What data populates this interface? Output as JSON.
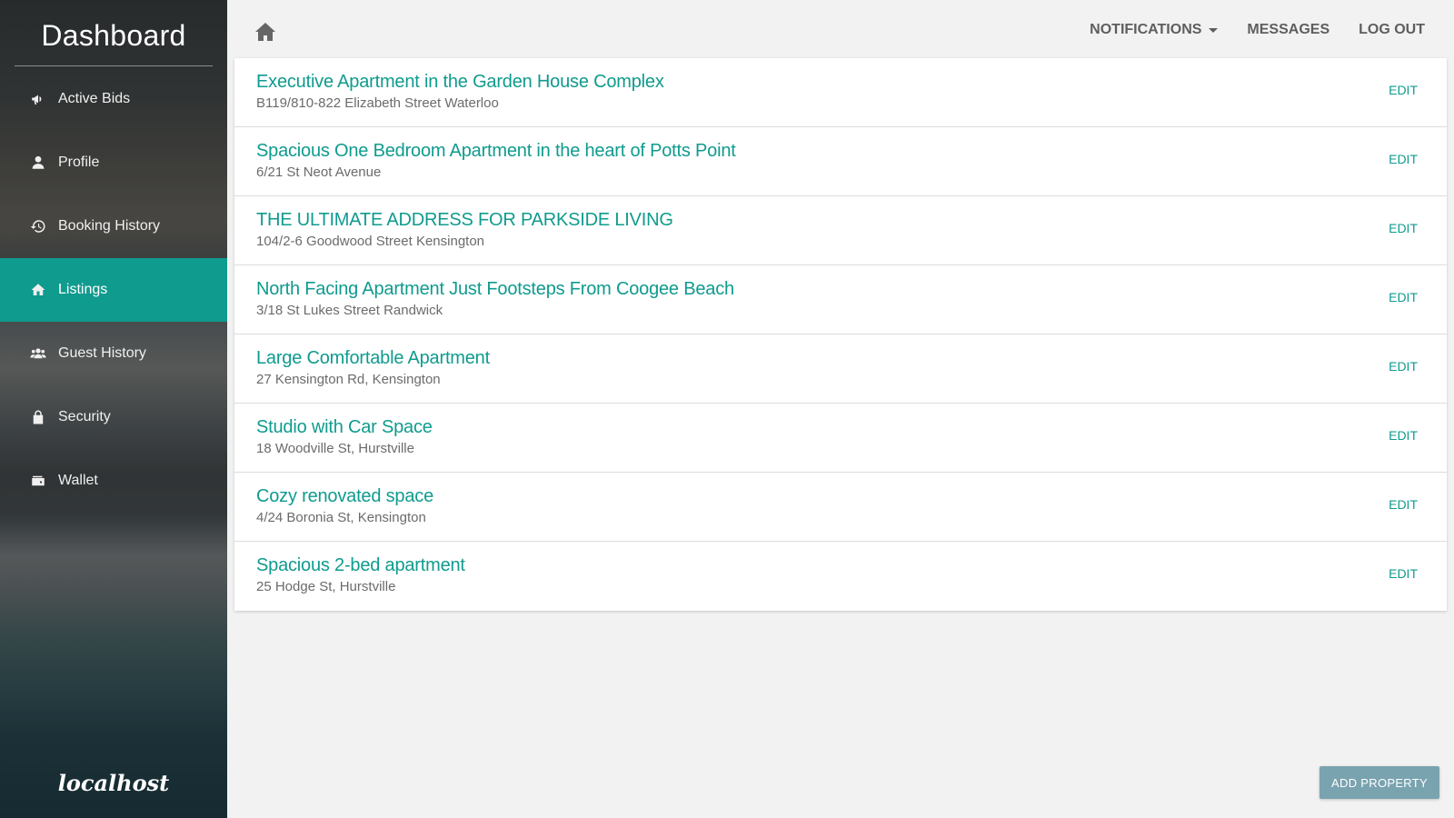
{
  "sidebar": {
    "title": "Dashboard",
    "logo": "localhost",
    "items": [
      {
        "label": "Active Bids",
        "icon": "megaphone-icon"
      },
      {
        "label": "Profile",
        "icon": "user-icon"
      },
      {
        "label": "Booking History",
        "icon": "history-icon"
      },
      {
        "label": "Listings",
        "icon": "home-icon",
        "active": true
      },
      {
        "label": "Guest History",
        "icon": "users-icon"
      },
      {
        "label": "Security",
        "icon": "lock-icon"
      },
      {
        "label": "Wallet",
        "icon": "wallet-icon"
      }
    ]
  },
  "topbar": {
    "home_icon": "home-icon",
    "notifications": "NOTIFICATIONS",
    "messages": "MESSAGES",
    "logout": "LOG OUT"
  },
  "listings": [
    {
      "title": "Executive Apartment in the Garden House Complex",
      "address": "B119/810-822 Elizabeth Street Waterloo",
      "action": "EDIT"
    },
    {
      "title": "Spacious One Bedroom Apartment in the heart of Potts Point",
      "address": "6/21 St Neot Avenue",
      "action": "EDIT"
    },
    {
      "title": "THE ULTIMATE ADDRESS FOR PARKSIDE LIVING",
      "address": "104/2-6 Goodwood Street Kensington",
      "action": "EDIT"
    },
    {
      "title": "North Facing Apartment Just Footsteps From Coogee Beach",
      "address": "3/18 St Lukes Street Randwick",
      "action": "EDIT"
    },
    {
      "title": "Large Comfortable Apartment",
      "address": "27 Kensington Rd, Kensington",
      "action": "EDIT"
    },
    {
      "title": "Studio with Car Space",
      "address": "18 Woodville St, Hurstville",
      "action": "EDIT"
    },
    {
      "title": "Cozy renovated space",
      "address": "4/24 Boronia St, Kensington",
      "action": "EDIT"
    },
    {
      "title": "Spacious 2-bed apartment",
      "address": "25 Hodge St, Hurstville",
      "action": "EDIT"
    }
  ],
  "add_property_label": "ADD PROPERTY",
  "colors": {
    "accent": "#0f9b8e",
    "button": "#7aa3b0",
    "background": "#f2f2f2"
  }
}
